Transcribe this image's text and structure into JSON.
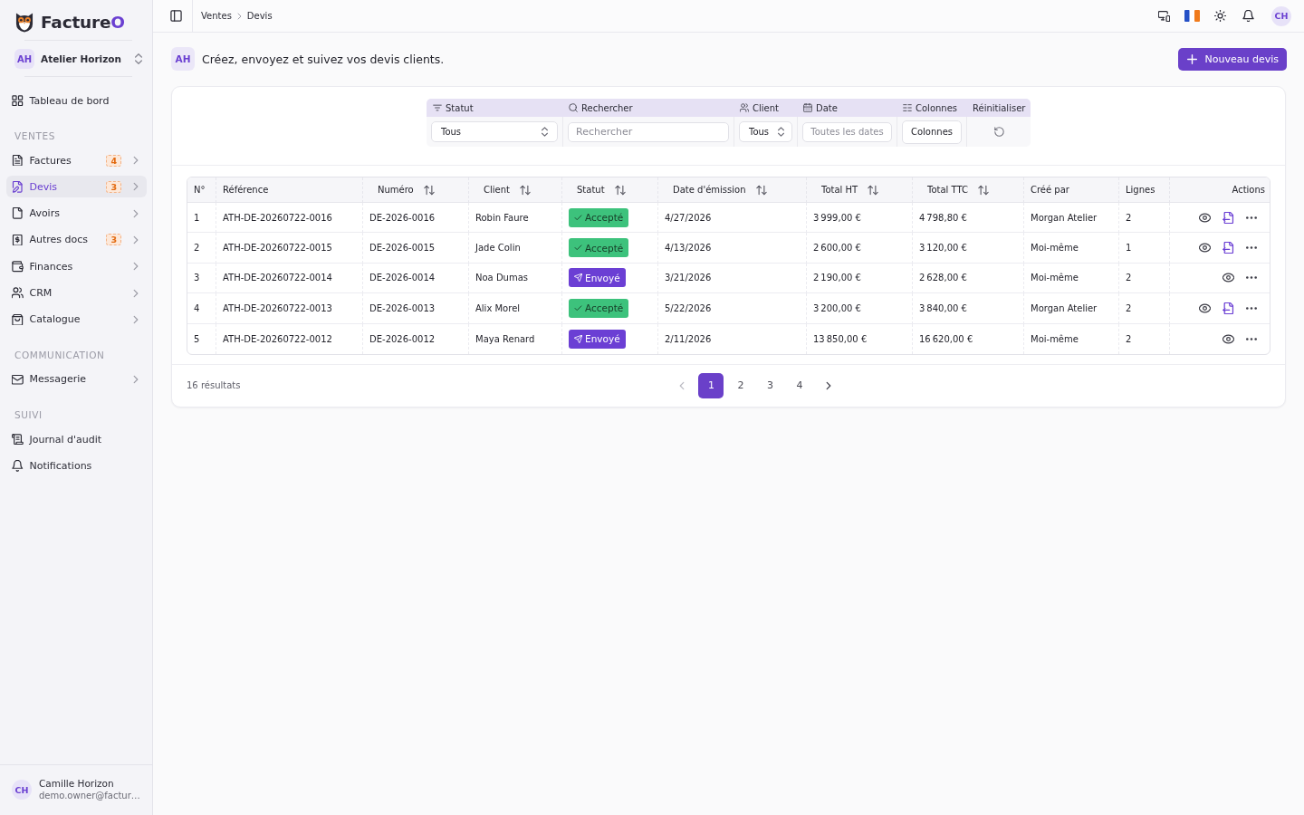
{
  "sidebar": {
    "logo": {
      "name": "Facture",
      "accent": "O"
    },
    "organization": {
      "initials": "AH",
      "name": "Atelier Horizon"
    },
    "top_items": [
      {
        "label": "Tableau de bord",
        "selected": false,
        "expandable": false
      }
    ],
    "sections": [
      {
        "title": "VENTES",
        "items": [
          {
            "label": "Factures",
            "selected": false,
            "badge": "4",
            "expandable": true
          },
          {
            "label": "Devis",
            "selected": true,
            "badge": "3",
            "expandable": true
          },
          {
            "label": "Avoirs",
            "selected": false,
            "expandable": true
          },
          {
            "label": "Autres docs",
            "selected": false,
            "badge": "3",
            "expandable": true
          },
          {
            "label": "Finances",
            "selected": false,
            "expandable": true
          },
          {
            "label": "CRM",
            "selected": false,
            "expandable": true
          },
          {
            "label": "Catalogue",
            "selected": false,
            "expandable": true
          }
        ]
      },
      {
        "title": "COMMUNICATION",
        "items": [
          {
            "label": "Messagerie",
            "selected": false,
            "expandable": true
          }
        ]
      },
      {
        "title": "SUIVI",
        "items": [
          {
            "label": "Journal d'audit",
            "selected": false,
            "expandable": false
          },
          {
            "label": "Notifications",
            "selected": false,
            "expandable": false
          }
        ]
      }
    ],
    "user": {
      "initials": "CH",
      "name": "Camille Horizon",
      "email": "demo.owner@factur…"
    }
  },
  "topbar": {
    "breadcrumb": [
      "Ventes",
      "Devis"
    ],
    "user_initials": "CH"
  },
  "header": {
    "initials": "AH",
    "description": "Créez, envoyez et suivez vos devis clients.",
    "primary_button": "Nouveau devis"
  },
  "filters": [
    {
      "label": "Statut",
      "kind": "select",
      "value": "Tous"
    },
    {
      "label": "Rechercher",
      "kind": "search",
      "placeholder": "Rechercher"
    },
    {
      "label": "Client",
      "kind": "select",
      "value": "Tous"
    },
    {
      "label": "Date",
      "kind": "date",
      "placeholder": "Toutes les dates"
    },
    {
      "label": "Colonnes",
      "kind": "button",
      "value": "Colonnes"
    },
    {
      "label": "Réinitialiser",
      "kind": "reset"
    }
  ],
  "table": {
    "columns": [
      {
        "label": "N°",
        "sortable": false
      },
      {
        "label": "Référence",
        "sortable": false
      },
      {
        "label": "Numéro",
        "sortable": true
      },
      {
        "label": "Client",
        "sortable": true
      },
      {
        "label": "Statut",
        "sortable": true
      },
      {
        "label": "Date d'émission",
        "sortable": true
      },
      {
        "label": "Total HT",
        "sortable": true
      },
      {
        "label": "Total TTC",
        "sortable": true
      },
      {
        "label": "Créé par",
        "sortable": false
      },
      {
        "label": "Lignes",
        "sortable": false
      },
      {
        "label": "Actions",
        "sortable": false
      }
    ],
    "rows": [
      {
        "number": "1",
        "reference": "ATH-DE-20260722-0016",
        "quote_number": "DE-2026-0016",
        "client": "Robin Faure",
        "status": {
          "label": "Accepté",
          "kind": "accepted"
        },
        "issue_date": "4/27/2026",
        "total_ht": "3 999,00 €",
        "total_ttc": "4 798,80 €",
        "created_by": "Morgan Atelier",
        "lines": "2",
        "convertible": true
      },
      {
        "number": "2",
        "reference": "ATH-DE-20260722-0015",
        "quote_number": "DE-2026-0015",
        "client": "Jade Colin",
        "status": {
          "label": "Accepté",
          "kind": "accepted"
        },
        "issue_date": "4/13/2026",
        "total_ht": "2 600,00 €",
        "total_ttc": "3 120,00 €",
        "created_by": "Moi-même",
        "lines": "1",
        "convertible": true
      },
      {
        "number": "3",
        "reference": "ATH-DE-20260722-0014",
        "quote_number": "DE-2026-0014",
        "client": "Noa Dumas",
        "status": {
          "label": "Envoyé",
          "kind": "sent"
        },
        "issue_date": "3/21/2026",
        "total_ht": "2 190,00 €",
        "total_ttc": "2 628,00 €",
        "created_by": "Moi-même",
        "lines": "2",
        "convertible": false
      },
      {
        "number": "4",
        "reference": "ATH-DE-20260722-0013",
        "quote_number": "DE-2026-0013",
        "client": "Alix Morel",
        "status": {
          "label": "Accepté",
          "kind": "accepted"
        },
        "issue_date": "5/22/2026",
        "total_ht": "3 200,00 €",
        "total_ttc": "3 840,00 €",
        "created_by": "Morgan Atelier",
        "lines": "2",
        "convertible": true
      },
      {
        "number": "5",
        "reference": "ATH-DE-20260722-0012",
        "quote_number": "DE-2026-0012",
        "client": "Maya Renard",
        "status": {
          "label": "Envoyé",
          "kind": "sent"
        },
        "issue_date": "2/11/2026",
        "total_ht": "13 850,00 €",
        "total_ttc": "16 620,00 €",
        "created_by": "Moi-même",
        "lines": "2",
        "convertible": false
      }
    ]
  },
  "footer": {
    "results": "16 résultats",
    "pagination": {
      "previous_disabled": true,
      "next_disabled": false,
      "pages": [
        {
          "label": "1",
          "selected": true
        },
        {
          "label": "2",
          "selected": false
        },
        {
          "label": "3",
          "selected": false
        },
        {
          "label": "4",
          "selected": false
        }
      ]
    }
  }
}
